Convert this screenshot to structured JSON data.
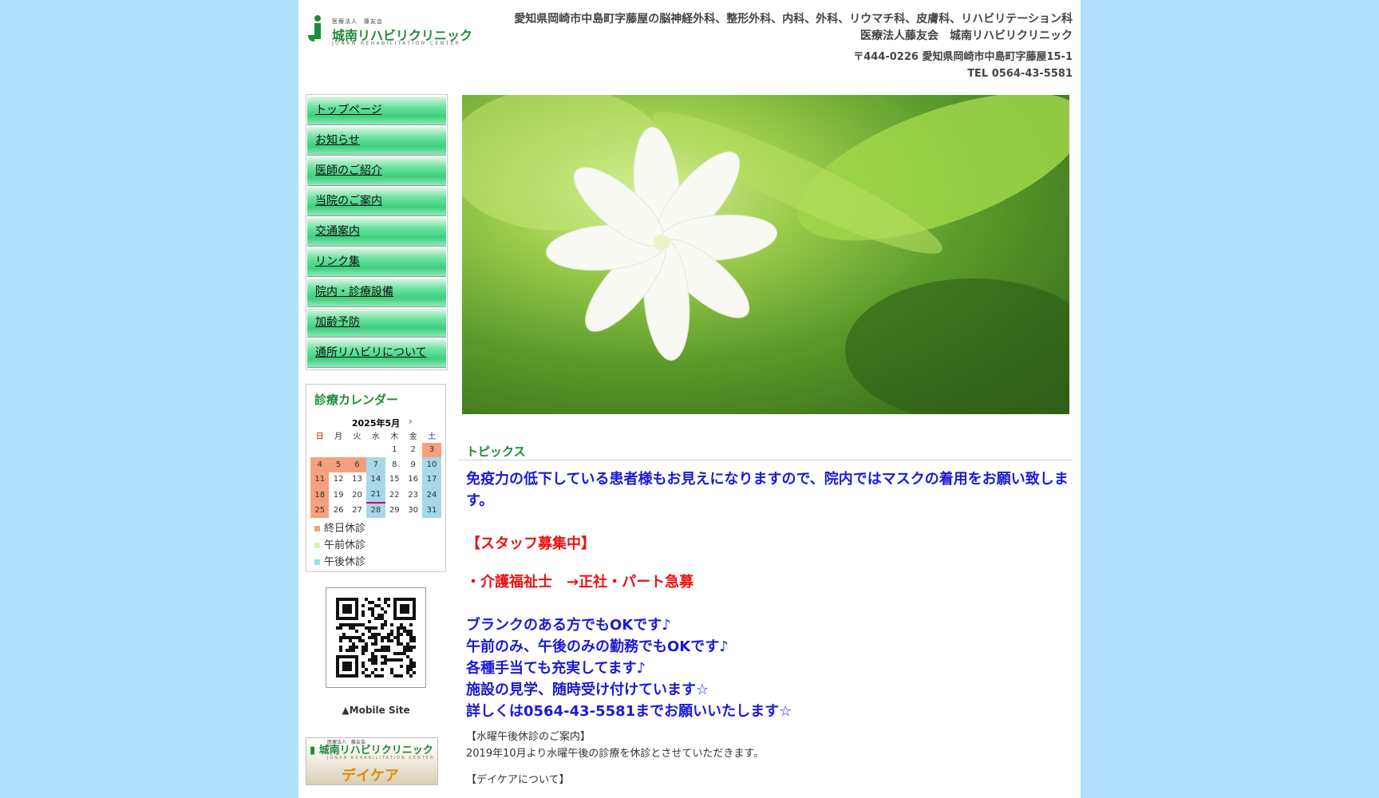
{
  "header": {
    "logo_small": "医療法人　藤友会",
    "logo_name": "城南リハビリクリニック",
    "logo_en": "JONAN REHABILITATION CENTER",
    "line1": "愛知県岡崎市中島町字藤屋の脳神経外科、整形外科、内科、外科、リウマチ科、皮膚科、リハビリテーション科",
    "line2": "医療法人藤友会　城南リハビリクリニック",
    "address": "〒444-0226 愛知県岡崎市中島町字藤屋15-1",
    "tel": "TEL 0564-43-5581"
  },
  "nav": [
    "トップページ",
    "お知らせ",
    "医師のご紹介",
    "当院のご案内",
    "交通案内",
    "リンク集",
    "院内・診療設備",
    "加齢予防",
    "通所リハビリについて"
  ],
  "calendar": {
    "title": "診療カレンダー",
    "month": "2025年5月",
    "next": "›",
    "weekdays": [
      "日",
      "月",
      "火",
      "水",
      "木",
      "金",
      "土"
    ],
    "weeks": [
      [
        "",
        "",
        "",
        "",
        "1",
        "2",
        "3"
      ],
      [
        "4",
        "5",
        "6",
        "7",
        "8",
        "9",
        "10"
      ],
      [
        "11",
        "12",
        "13",
        "14",
        "15",
        "16",
        "17"
      ],
      [
        "18",
        "19",
        "20",
        "21",
        "22",
        "23",
        "24"
      ],
      [
        "25",
        "26",
        "27",
        "28",
        "29",
        "30",
        "31"
      ]
    ],
    "legend": [
      {
        "label": "終日休診",
        "color": "#f5a07d"
      },
      {
        "label": "午前休診",
        "color": "#d4f5b0"
      },
      {
        "label": "午後休診",
        "color": "#a6d8e8"
      }
    ]
  },
  "mobile_link": "▲Mobile Site",
  "daycare_banner": {
    "small": "医療法人　藤友会",
    "name": "城南リハビリクリニック",
    "en": "JONAN REHABILITATION CENTER",
    "label": "デイケア"
  },
  "topics": {
    "heading": "トピックス",
    "mask_notice": "免疫力の低下している患者様もお見えになりますので、院内ではマスクの着用をお願い致します。",
    "recruit_title": "【スタッフ募集中】",
    "recruit_job": "・介護福祉士　→正社・パート急募",
    "recruit_lines": [
      "ブランクのある方でもOKです♪",
      "午前のみ、午後のみの勤務でもOKです♪",
      "各種手当ても充実してます♪",
      "施設の見学、随時受け付けています☆",
      "詳しくは0564-43-5581までお願いいたします☆"
    ],
    "wed_title": "【水曜午後休診のご案内】",
    "wed_text": "2019年10月より水曜午後の診療を休診とさせていただきます。",
    "daycare_title": "【デイケアについて】"
  }
}
